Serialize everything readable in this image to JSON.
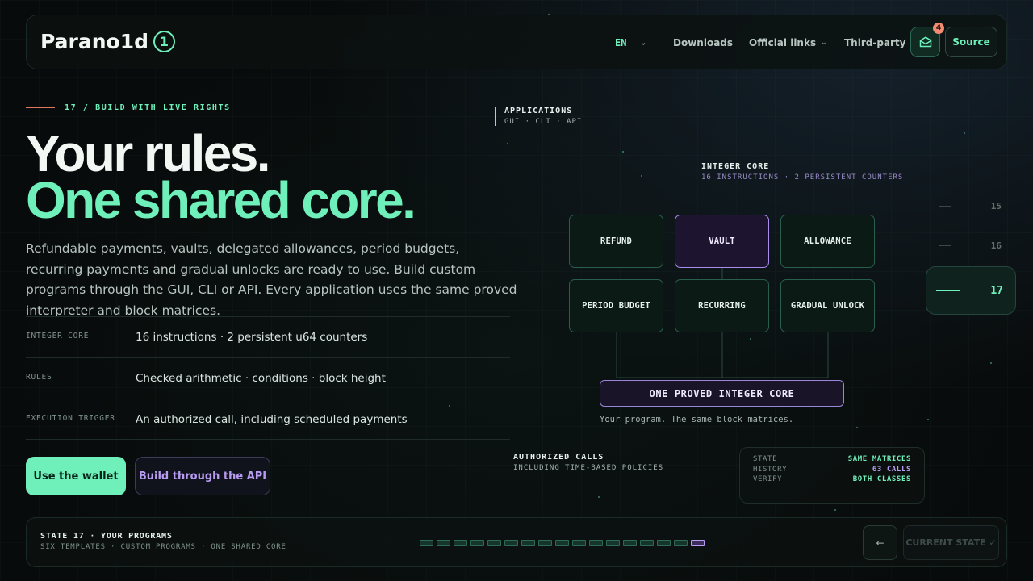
{
  "header": {
    "brand": "Parano1d",
    "brand_badge": "1",
    "nav": {
      "lang": "EN",
      "downloads": "Downloads",
      "official_links": "Official links",
      "third_party": "Third-party"
    },
    "mail_badge": "4",
    "source": "Source"
  },
  "hero": {
    "eyebrow": "17 / BUILD WITH LIVE RIGHTS",
    "title_line1": "Your rules.",
    "title_line2": "One shared core.",
    "lead": "Refundable payments, vaults, delegated allowances, period budgets, recurring payments and gradual unlocks are ready to use. Build custom programs through the GUI, CLI or API. Every application uses the same proved interpreter and block matrices."
  },
  "specs": [
    {
      "key": "INTEGER CORE",
      "value": "16 instructions · 2 persistent u64 counters"
    },
    {
      "key": "RULES",
      "value": "Checked arithmetic · conditions · block height"
    },
    {
      "key": "EXECUTION TRIGGER",
      "value": "An authorized call, including scheduled payments"
    }
  ],
  "cta": {
    "primary": "Use the wallet",
    "secondary": "Build through the API"
  },
  "diagram": {
    "applications": {
      "title": "APPLICATIONS",
      "sub": "GUI · CLI · API"
    },
    "integer_core": {
      "title": "INTEGER CORE",
      "sub": "16 INSTRUCTIONS · 2 PERSISTENT COUNTERS"
    },
    "templates": [
      "REFUND",
      "VAULT",
      "ALLOWANCE",
      "PERIOD BUDGET",
      "RECURRING",
      "GRADUAL UNLOCK"
    ],
    "active_template": "VAULT",
    "core_box": "ONE PROVED INTEGER CORE",
    "core_caption": "Your program. The same block matrices.",
    "authorized": {
      "title": "AUTHORIZED CALLS",
      "sub": "INCLUDING TIME-BASED POLICIES"
    },
    "state_card": [
      {
        "key": "STATE",
        "value": "SAME MATRICES",
        "color": "#6ff0bb"
      },
      {
        "key": "HISTORY",
        "value": "63 CALLS",
        "color": "#b89cf2"
      },
      {
        "key": "VERIFY",
        "value": "BOTH CLASSES",
        "color": "#6ff0bb"
      }
    ]
  },
  "rail": {
    "items": [
      "15",
      "16"
    ],
    "active": "17"
  },
  "footer": {
    "title": "STATE 17 · YOUR PROGRAMS",
    "sub": "SIX TEMPLATES · CUSTOM PROGRAMS · ONE SHARED CORE",
    "steps_total": 17,
    "current_step": 17,
    "prev_label": "←",
    "current_label": "CURRENT STATE ✓"
  },
  "colors": {
    "accent_green": "#6ff0bb",
    "accent_purple": "#b89cf2",
    "accent_coral": "#e0795e",
    "background": "#080b0b"
  }
}
